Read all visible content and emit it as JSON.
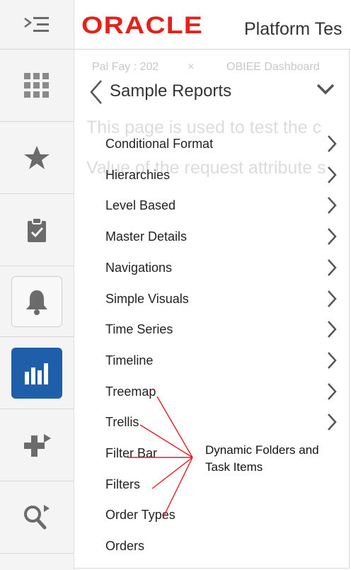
{
  "header": {
    "brand": "ORACLE",
    "app_title": "Platform Tes",
    "background_hints": [
      "Pal Fay : 202",
      "×",
      "OBIEE Dashboard"
    ],
    "background_text_1": "This page is used to test the c",
    "background_text_2": "Value of the request attribute s"
  },
  "sidebar": {
    "items": [
      {
        "icon": "menu-icon"
      },
      {
        "icon": "grid-icon"
      },
      {
        "icon": "star-icon"
      },
      {
        "icon": "clipboard-check-icon"
      },
      {
        "icon": "bell-icon"
      },
      {
        "icon": "bar-chart-icon",
        "active": true
      },
      {
        "icon": "plus-arrow-icon"
      },
      {
        "icon": "search-arrow-icon"
      }
    ]
  },
  "panel": {
    "title": "Sample Reports",
    "items": [
      {
        "label": "Conditional Format",
        "has_children": true
      },
      {
        "label": "Hierarchies",
        "has_children": true
      },
      {
        "label": "Level Based",
        "has_children": true
      },
      {
        "label": "Master Details",
        "has_children": true
      },
      {
        "label": "Navigations",
        "has_children": true
      },
      {
        "label": "Simple Visuals",
        "has_children": true
      },
      {
        "label": "Time Series",
        "has_children": true
      },
      {
        "label": "Timeline",
        "has_children": true
      },
      {
        "label": "Treemap",
        "has_children": true
      },
      {
        "label": "Trellis",
        "has_children": true
      },
      {
        "label": "Filter Bar",
        "has_children": false
      },
      {
        "label": "Filters",
        "has_children": false
      },
      {
        "label": "Order Types",
        "has_children": false
      },
      {
        "label": "Orders",
        "has_children": false
      }
    ]
  },
  "annotation": {
    "line1": "Dynamic Folders and",
    "line2": "Task Items",
    "color": "#e31b23"
  },
  "colors": {
    "brand_red": "#e3231b",
    "active_tile": "#1f5ea8",
    "icon_gray": "#6b6b6b"
  }
}
